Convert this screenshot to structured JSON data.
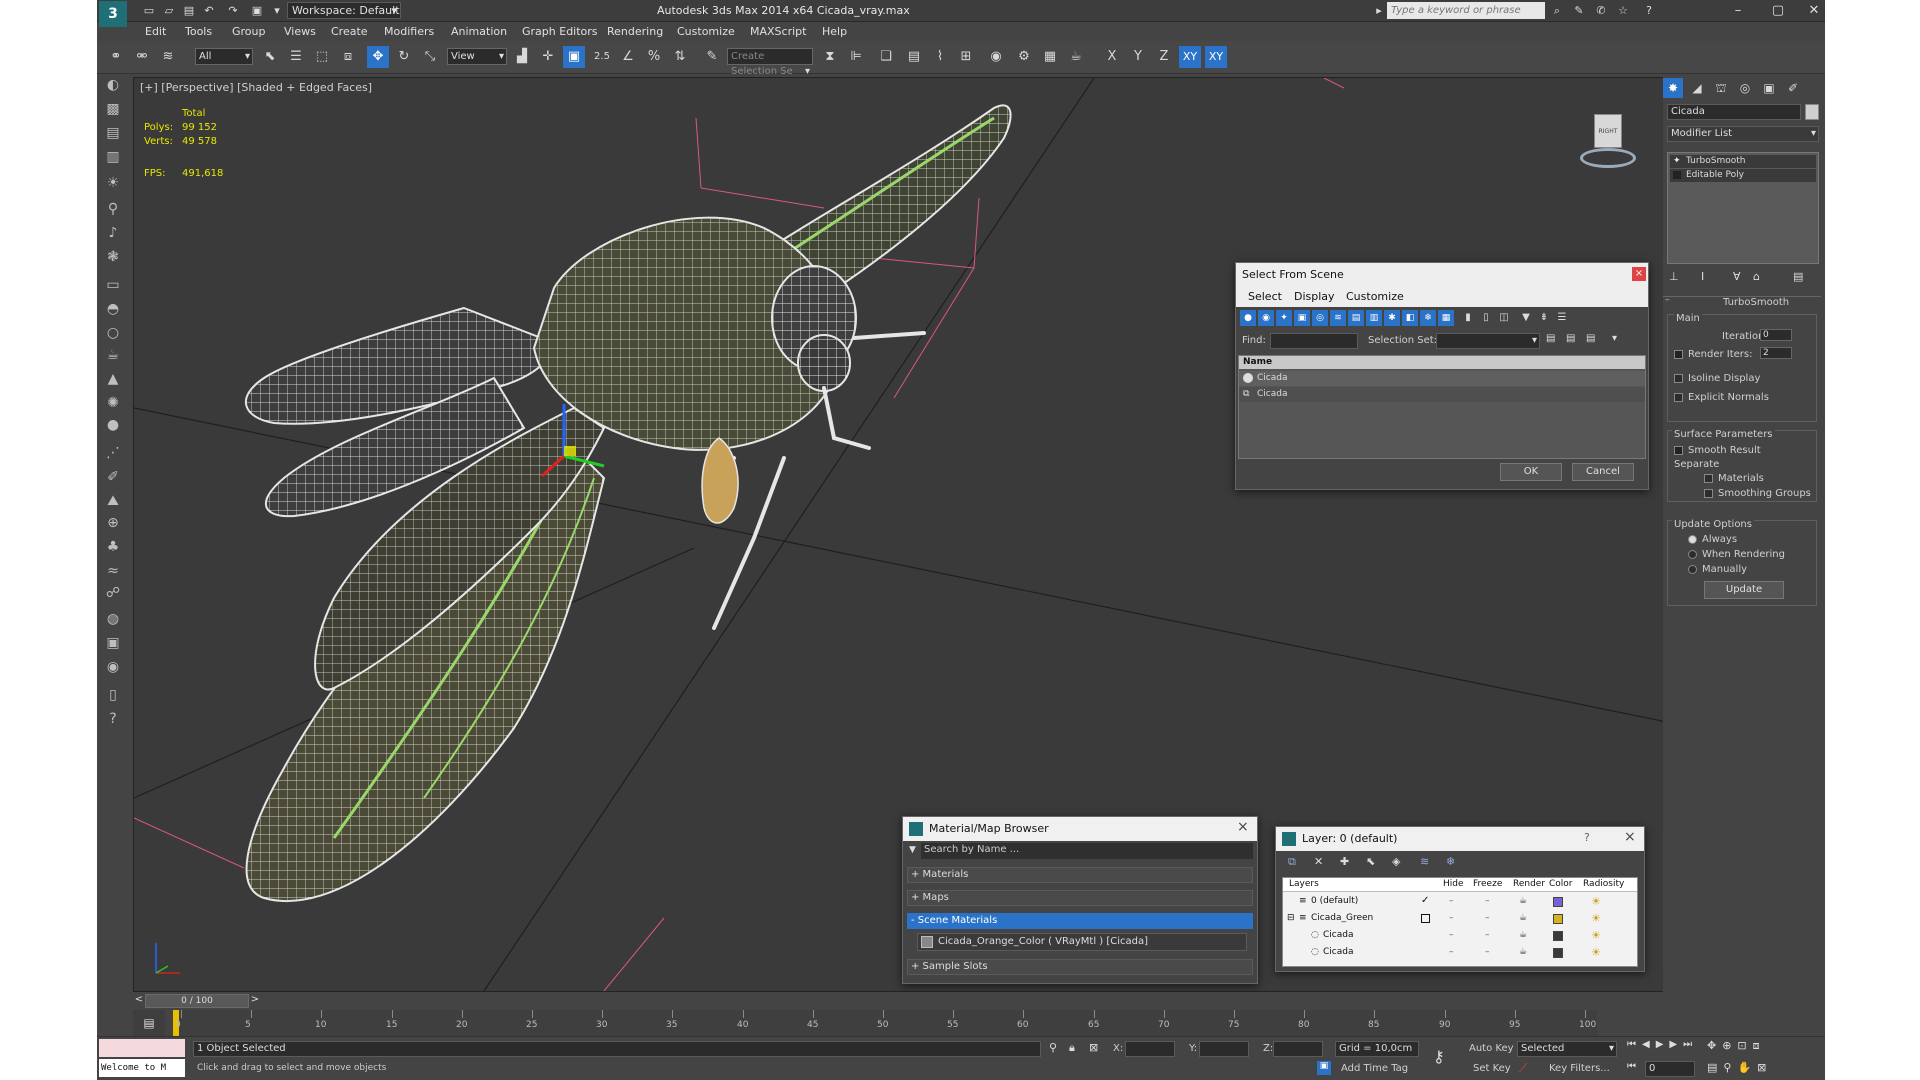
{
  "window": {
    "title": "Autodesk 3ds Max  2014 x64     Cicada_vray.max",
    "workspace": "Workspace: Default",
    "search_placeholder": "Type a keyword or phrase",
    "logo_glyph": "3"
  },
  "menubar": [
    "Edit",
    "Tools",
    "Group",
    "Views",
    "Create",
    "Modifiers",
    "Animation",
    "Graph Editors",
    "Rendering",
    "Customize",
    "MAXScript",
    "Help"
  ],
  "toolbar": {
    "filter_value": "All",
    "refcoord_value": "View",
    "snap_label": "2.5",
    "selection_set_placeholder": "Create Selection Se",
    "axis_labels": [
      "X",
      "Y",
      "Z",
      "XY",
      "XY"
    ]
  },
  "viewport": {
    "label": "[+] [Perspective] [Shaded + Edged Faces]",
    "stats": {
      "total_label": "Total",
      "polys_label": "Polys:",
      "polys_value": "99 152",
      "verts_label": "Verts:",
      "verts_value": "49 578",
      "fps_label": "FPS:",
      "fps_value": "491,618"
    },
    "viewcube_label": "RIGHT"
  },
  "command_panel": {
    "object_name": "Cicada",
    "modifier_list_label": "Modifier List",
    "stack": [
      "TurboSmooth",
      "Editable Poly"
    ],
    "rollout_title": "TurboSmooth",
    "main_label": "Main",
    "iterations_label": "Iterations:",
    "iterations_value": "0",
    "render_iters_label": "Render Iters:",
    "render_iters_value": "2",
    "isoline_label": "Isoline Display",
    "explicit_normals_label": "Explicit Normals",
    "surface_params_label": "Surface Parameters",
    "smooth_result_label": "Smooth Result",
    "separate_label": "Separate",
    "materials_label": "Materials",
    "smoothing_groups_label": "Smoothing Groups",
    "update_options_label": "Update Options",
    "always_label": "Always",
    "when_rendering_label": "When Rendering",
    "manually_label": "Manually",
    "update_button": "Update"
  },
  "select_from_scene": {
    "title": "Select From Scene",
    "close_glyph": "×",
    "menu": [
      "Select",
      "Display",
      "Customize"
    ],
    "find_label": "Find:",
    "selection_set_label": "Selection Set:",
    "column_name": "Name",
    "rows": [
      "Cicada",
      "Cicada"
    ],
    "ok_button": "OK",
    "cancel_button": "Cancel"
  },
  "material_browser": {
    "title": "Material/Map Browser",
    "search_placeholder": "Search by Name ...",
    "sections": [
      "+ Materials",
      "+ Maps",
      "- Scene Materials"
    ],
    "scene_material": "Cicada_Orange_Color  ( VRayMtl )  [Cicada]",
    "sample_slots": "+ Sample Slots",
    "close_glyph": "×"
  },
  "layer_dialog": {
    "title": "Layer: 0 (default)",
    "help_glyph": "?",
    "close_glyph": "×",
    "columns": [
      "Layers",
      "Hide",
      "Freeze",
      "Render",
      "Color",
      "Radiosity"
    ],
    "rows": [
      {
        "name": "0 (default)",
        "color": "#7b5fd6"
      },
      {
        "name": "Cicada_Green",
        "color": "#d6b21f"
      },
      {
        "name": "Cicada",
        "color": "#3a3a3a"
      },
      {
        "name": "Cicada",
        "color": "#3a3a3a"
      }
    ]
  },
  "timeline": {
    "frame_label": "0 / 100",
    "ticks": [
      "0",
      "5",
      "10",
      "15",
      "20",
      "25",
      "30",
      "35",
      "40",
      "45",
      "50",
      "55",
      "60",
      "65",
      "70",
      "75",
      "80",
      "85",
      "90",
      "95",
      "100"
    ]
  },
  "status": {
    "maxscript_text": "Welcome to M",
    "selected_text": "1 Object Selected",
    "prompt_text": "Click and drag to select and move objects",
    "x_label": "X:",
    "y_label": "Y:",
    "z_label": "Z:",
    "grid_text": "Grid = 10,0cm",
    "add_time_tag": "Add Time Tag",
    "auto_key": "Auto Key",
    "set_key": "Set Key",
    "selected_dropdown": "Selected",
    "key_filters": "Key Filters...",
    "frame_value": "0"
  },
  "colors": {
    "accent_blue": "#2a73c9",
    "wire_white": "#e6e6e6",
    "wire_green": "#8bcf5a",
    "viewport_bg": "#3a3a3a"
  }
}
